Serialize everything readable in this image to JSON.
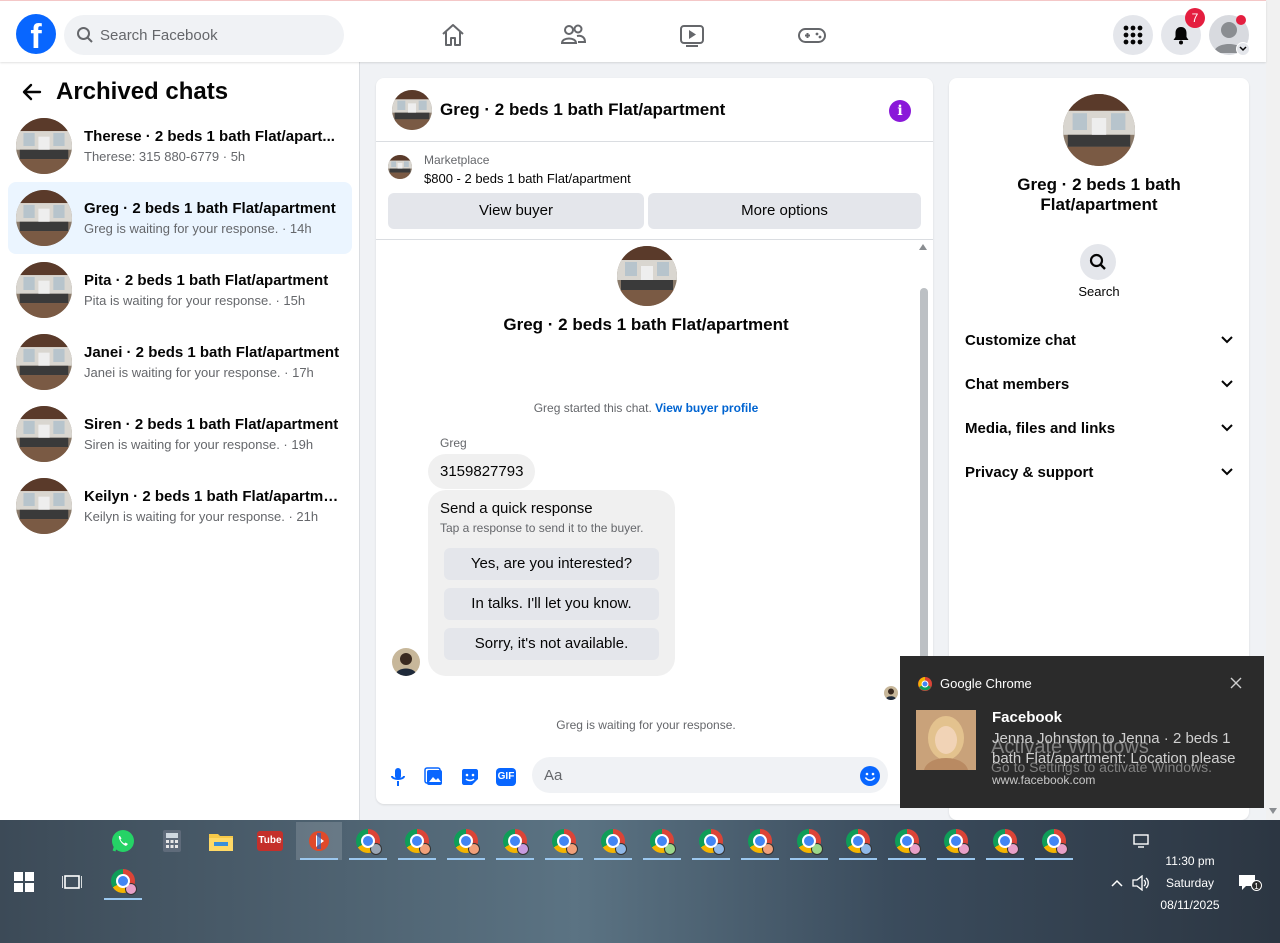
{
  "topbar": {
    "logo_letter": "f",
    "search_placeholder": "Search Facebook",
    "notification_count": "7"
  },
  "sidebar": {
    "title": "Archived chats",
    "chats": [
      {
        "name": "Therese · 2 beds 1 bath Flat/apart...",
        "sub": "Therese: 315 880-6779 · 5h"
      },
      {
        "name": "Greg · 2 beds 1 bath Flat/apartment",
        "sub": "Greg is waiting for your response. · 14h"
      },
      {
        "name": "Pita · 2 beds 1 bath Flat/apartment",
        "sub": "Pita is waiting for your response. · 15h"
      },
      {
        "name": "Janei · 2 beds 1 bath Flat/apartment",
        "sub": "Janei is waiting for your response. · 17h"
      },
      {
        "name": "Siren · 2 beds 1 bath Flat/apartment",
        "sub": "Siren is waiting for your response. · 19h"
      },
      {
        "name": "Keilyn · 2 beds 1 bath Flat/apartme...",
        "sub": "Keilyn is waiting for your response. · 21h"
      }
    ]
  },
  "chat": {
    "header_title": "Greg · 2 beds 1 bath Flat/apartment",
    "info_glyph": "i",
    "marketplace_label": "Marketplace",
    "listing": "$800 - 2 beds 1 bath Flat/apartment",
    "view_buyer": "View buyer",
    "more_options": "More options",
    "center_name": "Greg · 2 beds 1 bath Flat/apartment",
    "started_text": "Greg started this chat.",
    "view_buyer_profile": "View buyer profile",
    "sender": "Greg",
    "message": "3159827793",
    "quick_title": "Send a quick response",
    "quick_sub": "Tap a response to send it to the buyer.",
    "quick_replies": [
      "Yes, are you interested?",
      "In talks. I'll let you know.",
      "Sorry, it's not available."
    ],
    "waiting": "Greg is waiting for your response.",
    "composer_placeholder": "Aa",
    "gif_label": "GIF"
  },
  "info_panel": {
    "name": "Greg · 2 beds 1 bath Flat/apartment",
    "search_label": "Search",
    "rows": [
      "Customize chat",
      "Chat members",
      "Media, files and links",
      "Privacy & support"
    ]
  },
  "toast": {
    "app": "Google Chrome",
    "title": "Facebook",
    "body": "Jenna Johnston to Jenna · 2 beds 1 bath Flat/apartment: Location please",
    "url": "www.facebook.com"
  },
  "watermark": {
    "line1": "Activate Windows",
    "line2": "Go to Settings to activate Windows."
  },
  "taskbar": {
    "time": "11:30 pm",
    "day": "Saturday",
    "date": "08/11/2025",
    "youtube_label": "Tube",
    "action_center_count": "1"
  },
  "colors": {
    "facebook_blue": "#0866ff",
    "active_chat_bg": "#ebf5ff",
    "info_purple": "#8a18d9",
    "badge_red": "#e41e3f"
  }
}
